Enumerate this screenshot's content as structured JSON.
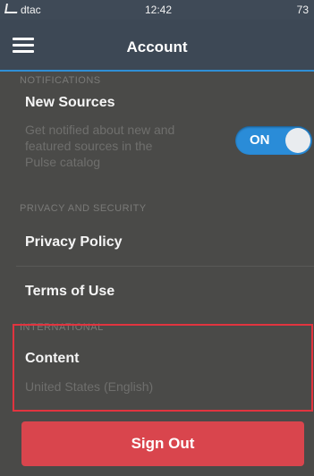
{
  "status_bar": {
    "carrier": "dtac",
    "time": "12:42",
    "battery": "73"
  },
  "nav": {
    "title": "Account"
  },
  "notifications": {
    "section_label": "NOTIFICATIONS",
    "new_sources_title": "New Sources",
    "new_sources_desc_line1": "Get notified about new and",
    "new_sources_desc_line2": "featured sources in the",
    "new_sources_desc_line3": "Pulse catalog",
    "toggle_label": "ON"
  },
  "privacy": {
    "section_label": "PRIVACY AND SECURITY",
    "privacy_policy": "Privacy Policy",
    "terms_of_use": "Terms of Use"
  },
  "international": {
    "section_label": "INTERNATIONAL",
    "content_title": "Content",
    "content_value": "United States (English)"
  },
  "sign_out": {
    "label": "Sign Out"
  },
  "colors": {
    "toggle_on": "#2a8cd8",
    "sign_out_button": "#d9454d",
    "highlight_border": "#e1343f",
    "nav_accent": "#2f8fd6"
  }
}
